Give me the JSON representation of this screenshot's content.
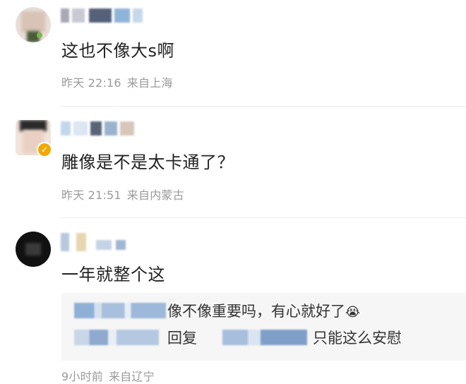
{
  "comments": [
    {
      "text": "这也不像大s啊",
      "time": "昨天 22:16",
      "location": "来自上海"
    },
    {
      "text": "雕像是不是太卡通了？",
      "time": "昨天 21:51",
      "location": "来自内蒙古"
    },
    {
      "text": "一年就整个这",
      "reply": {
        "line1": "像不像重要吗，有心就好了",
        "line1_emoji": "😭",
        "line2_prefix": "回复",
        "line2": "只能这么安慰"
      },
      "time": "9小时前",
      "location": "来自辽宁"
    }
  ],
  "icons": {
    "verified": "verified-badge-icon",
    "emoji": "crying-face-icon"
  },
  "colors": {
    "meta": "#9a9a9a",
    "verified": "#f2a900",
    "reply_bg": "#f6f6f6"
  }
}
